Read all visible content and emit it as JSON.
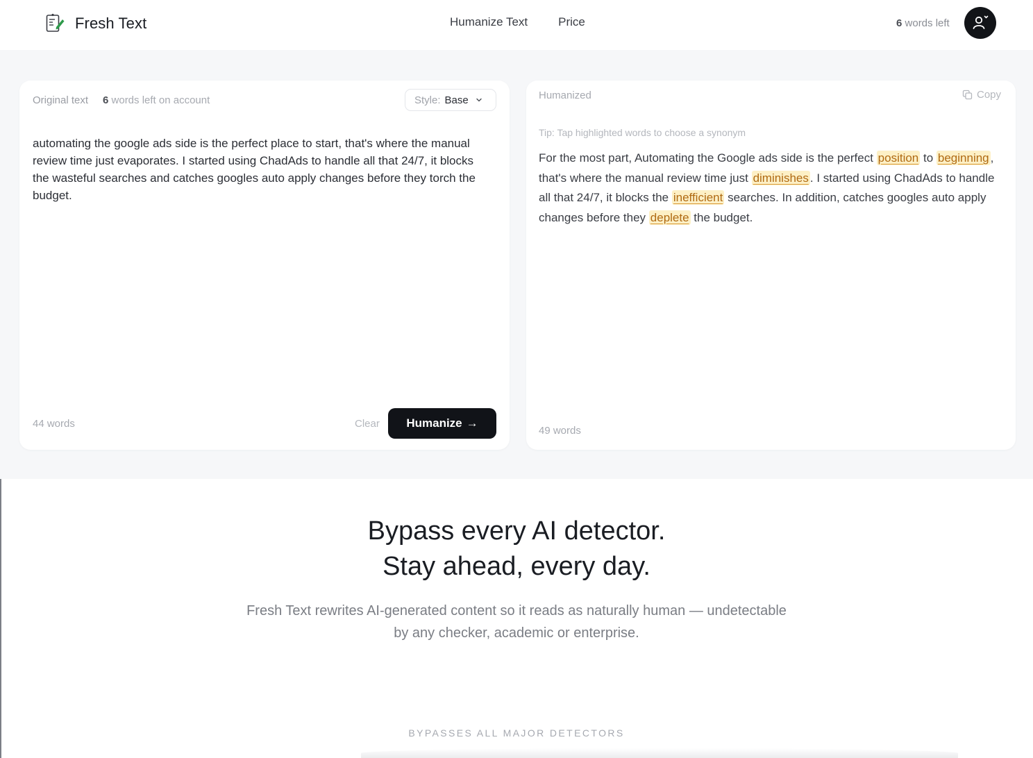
{
  "brand": {
    "name": "Fresh Text",
    "logo_icon": "document-edit-icon"
  },
  "nav": {
    "items": [
      {
        "label": "Humanize Text"
      },
      {
        "label": "Price"
      }
    ]
  },
  "account": {
    "words_left_count": "6",
    "words_left_suffix": "words left",
    "avatar_icon": "user-icon"
  },
  "input_panel": {
    "label": "Original text",
    "count": "6",
    "count_suffix": "words left on account",
    "style_label": "Style:",
    "style_value": "Base",
    "text": "automating the google ads side is the perfect place to start, that's where the manual review time just evaporates. I started using ChadAds to handle all that 24/7, it blocks the wasteful searches and catches googles auto apply changes before they torch the budget.",
    "word_count": "44 words",
    "clear_label": "Clear",
    "humanize_label": "Humanize",
    "humanize_arrow": "→"
  },
  "output_panel": {
    "label": "Humanized",
    "copy_label": "Copy",
    "tip": "Tip: Tap highlighted words to choose a synonym",
    "segments": [
      "For the most part, Automating the Google ads side is the perfect ",
      "position",
      " to ",
      "beginning",
      ", that's where the manual review time just ",
      "diminishes",
      ". I started using ChadAds to handle all that 24/7, it blocks the ",
      "inefficient",
      " searches. In addition, catches googles auto apply changes before they ",
      "deplete",
      " the budget."
    ],
    "word_count": "49 words",
    "highlight_color": "#fdf0c6",
    "highlight_text_color": "#b06a12"
  },
  "hero": {
    "title_line1": "Bypass every AI detector.",
    "title_line2": "Stay ahead, every day.",
    "subtitle": "Fresh Text rewrites AI-generated content so it reads as naturally human — undetectable by any checker, academic or enterprise.",
    "detectors_label": "BYPASSES ALL MAJOR DETECTORS"
  },
  "colors": {
    "primary_button": "#111318",
    "workspace_bg": "#f6f7f9"
  }
}
